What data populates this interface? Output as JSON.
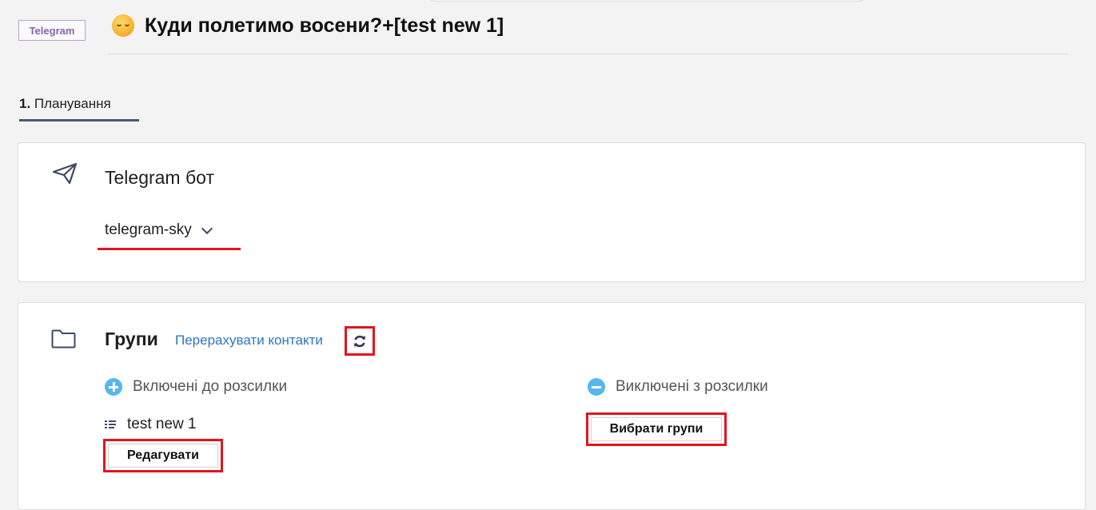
{
  "header": {
    "channel_badge": "Telegram",
    "title": "Куди полетимо восени?+[test new 1]"
  },
  "steps": [
    {
      "number": "1.",
      "label": "Планування"
    }
  ],
  "bot_card": {
    "title": "Telegram бот",
    "selected_bot": "telegram-sky"
  },
  "groups_card": {
    "title": "Групи",
    "recalc_link": "Перерахувати контакти",
    "included": {
      "heading": "Включені до розсилки",
      "items": [
        "test new 1"
      ],
      "edit_button": "Редагувати"
    },
    "excluded": {
      "heading": "Виключені з розсилки",
      "select_button": "Вибрати групи"
    }
  },
  "colors": {
    "accent_blue": "#2f73c8",
    "circle_blue": "#57b6f0",
    "highlight_red": "#e3151c",
    "badge_purple": "#8a63b1",
    "tab_underline": "#4a5878"
  }
}
